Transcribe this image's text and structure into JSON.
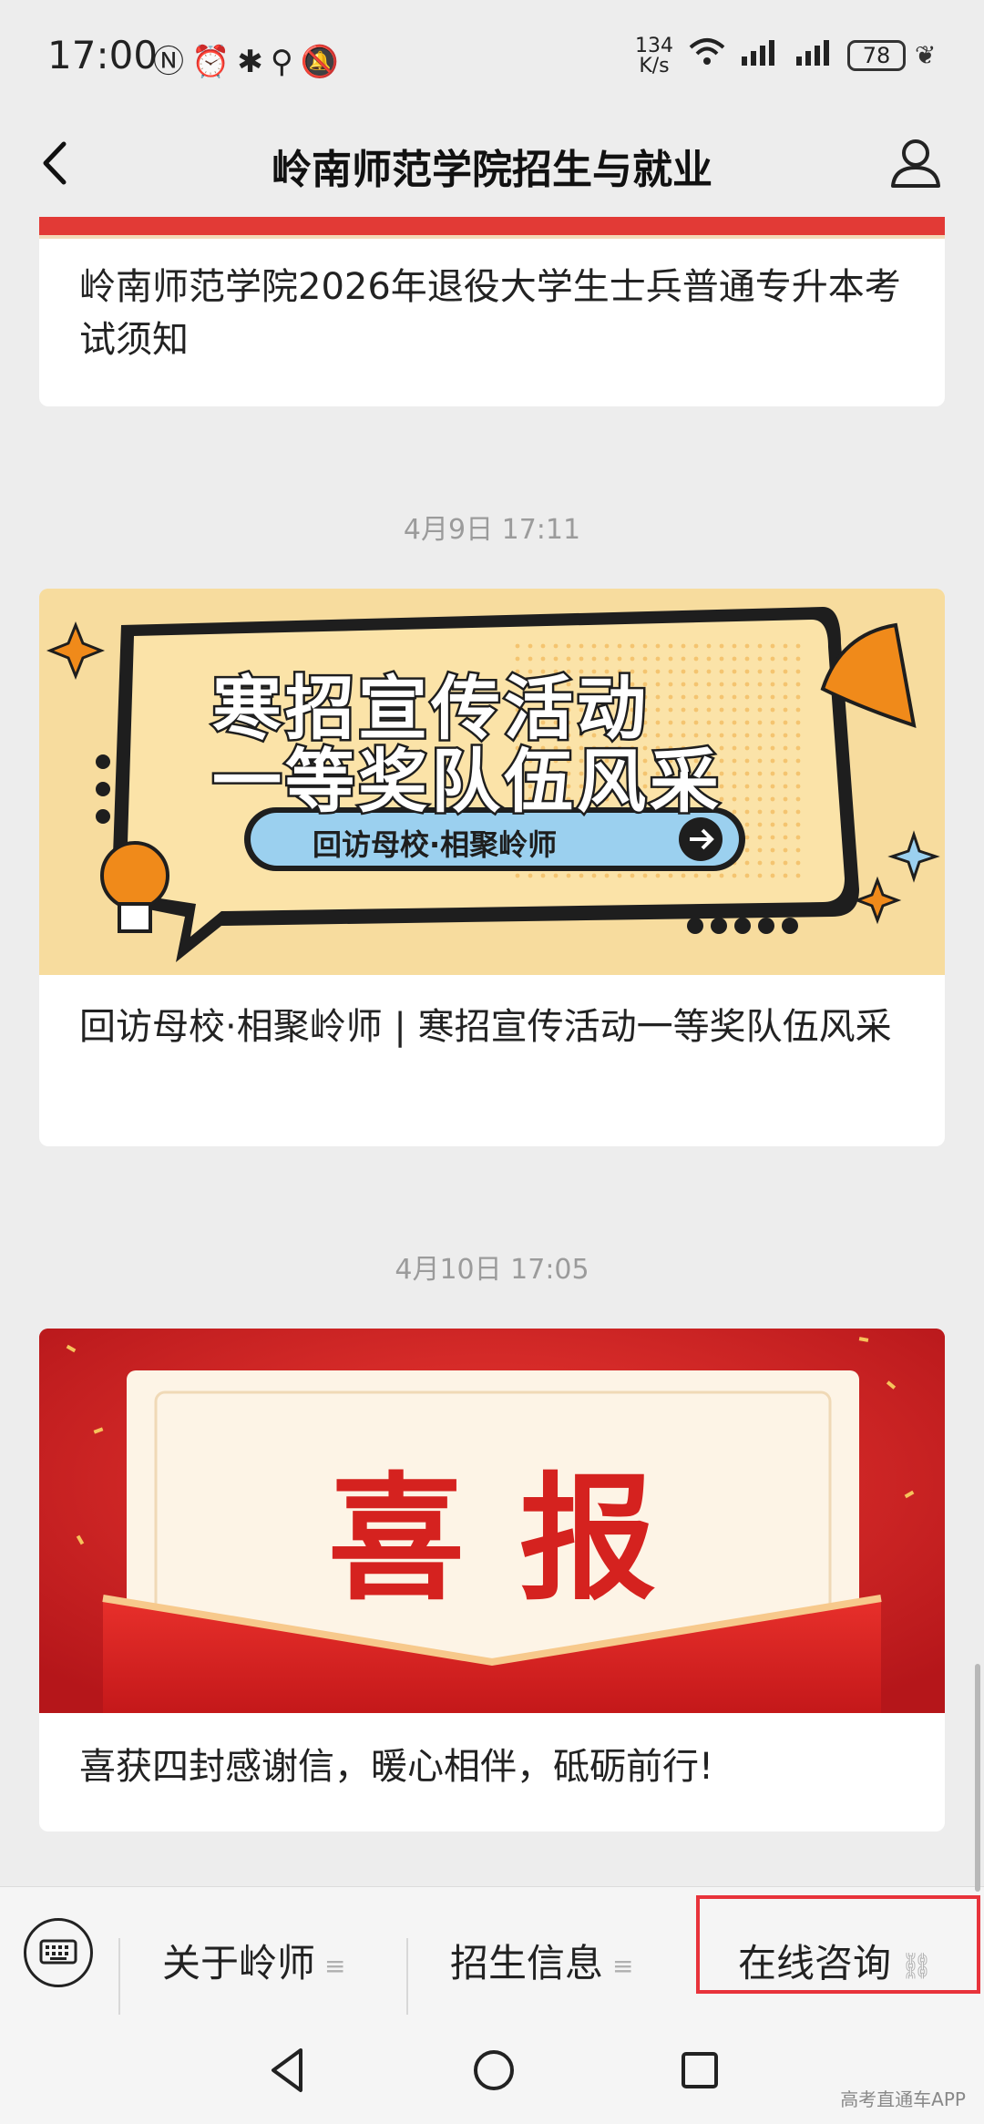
{
  "status": {
    "time": "17:00",
    "speed_top": "134",
    "speed_bottom": "K/s",
    "net": "6",
    "battery": "78"
  },
  "header": {
    "title": "岭南师范学院招生与就业"
  },
  "cards": [
    {
      "title": "岭南师范学院2026年退役大学生士兵普通专升本考试须知"
    },
    {
      "timestamp": "4月9日 17:11",
      "banner_line1": "寒招宣传活动",
      "banner_line2": "一等奖队伍风采",
      "banner_pill": "回访母校·相聚岭师",
      "title": "回访母校·相聚岭师 | 寒招宣传活动一等奖队伍风采"
    },
    {
      "timestamp": "4月10日 17:05",
      "banner_text": "喜报",
      "title": "喜获四封感谢信，暖心相伴，砥砺前行!"
    }
  ],
  "bottom_menu": {
    "items": [
      "关于岭师",
      "招生信息",
      "在线咨询"
    ],
    "highlight_color": "#e8333b"
  },
  "watermark": "高考直通车APP",
  "colors": {
    "accent_red": "#d92a2a",
    "banner_yellow": "#f6c86a",
    "banner_blue": "#9bd0ef"
  }
}
